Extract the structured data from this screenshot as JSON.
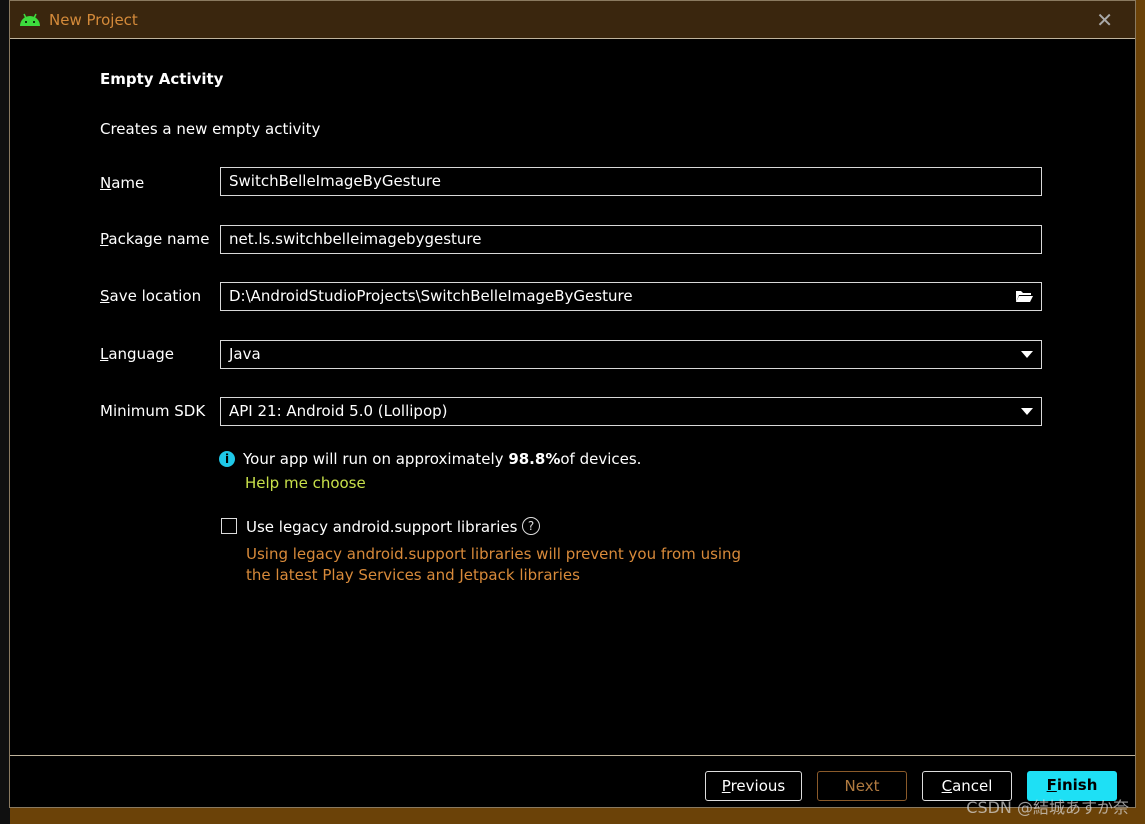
{
  "window": {
    "title": "New Project",
    "close_icon": "close-icon"
  },
  "page": {
    "heading": "Empty Activity",
    "description": "Creates a new empty activity"
  },
  "form": {
    "name": {
      "mnemonic": "N",
      "label_rest": "ame",
      "value": "SwitchBelleImageByGesture"
    },
    "package": {
      "mnemonic": "P",
      "label_rest": "ackage name",
      "value": "net.ls.switchbelleimagebygesture"
    },
    "save": {
      "mnemonic": "S",
      "label_rest": "ave location",
      "value": "D:\\AndroidStudioProjects\\SwitchBelleImageByGesture"
    },
    "language": {
      "mnemonic": "L",
      "label_rest": "anguage",
      "value": "Java"
    },
    "min_sdk": {
      "label": "Minimum SDK",
      "value": "API 21: Android 5.0 (Lollipop)"
    }
  },
  "info": {
    "pre": "Your app will run on approximately ",
    "percent": "98.8%",
    "post": " of devices.",
    "help_link": "Help me choose"
  },
  "legacy": {
    "label": "Use legacy android.support libraries",
    "checked": false,
    "warning_line1": "Using legacy android.support libraries will prevent you from using",
    "warning_line2": "the latest Play Services and Jetpack libraries"
  },
  "buttons": {
    "previous": {
      "mnemonic": "P",
      "rest": "revious"
    },
    "next": "Next",
    "cancel": {
      "mnemonic": "C",
      "rest": "ancel"
    },
    "finish": {
      "mnemonic": "F",
      "rest": "inish"
    }
  },
  "watermark": "CSDN @結城あすか奈",
  "colors": {
    "accent": "#1ee0f5",
    "title_text": "#d48a3a",
    "link": "#c8e04a",
    "warning": "#d88a3a"
  }
}
